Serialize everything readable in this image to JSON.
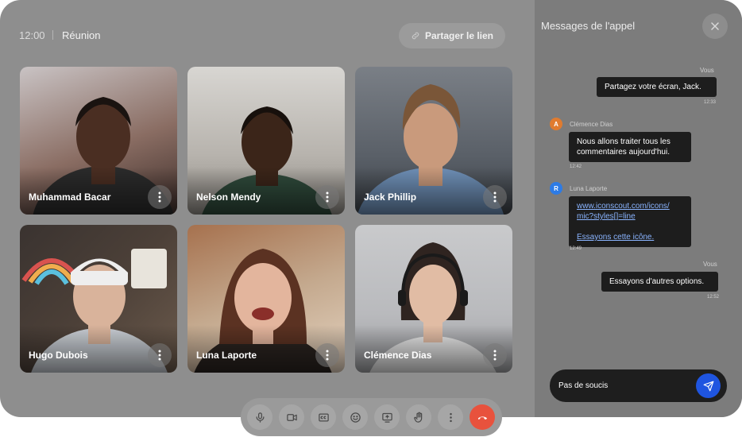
{
  "header": {
    "time": "12:00",
    "meeting_title": "Réunion",
    "share_label": "Partager le lien",
    "share_icon": "link-icon"
  },
  "participants": [
    {
      "name": "Muhammad Bacar",
      "bg": "#8a6d63",
      "skin": "#4a2e22",
      "hair": "#1a1310",
      "shirt": "#2b2b2b"
    },
    {
      "name": "Nelson Mendy",
      "bg": "#b7b3ad",
      "skin": "#3b2519",
      "hair": "#17100c",
      "shirt": "#2f4a3b"
    },
    {
      "name": "Jack Phillip",
      "bg": "#5a6068",
      "skin": "#c99a7c",
      "hair": "#7a5638",
      "shirt": "#6e8fb6"
    },
    {
      "name": "Hugo Dubois",
      "bg": "#4c4038",
      "skin": "#d9b39b",
      "hair": "#eeeeee",
      "shirt": "#c7ccd2"
    },
    {
      "name": "Luna Laporte",
      "bg": "#c4a98e",
      "skin": "#e3b59d",
      "hair": "#5b3222",
      "shirt": "#2b2420"
    },
    {
      "name": "Clémence Dias",
      "bg": "#b9babd",
      "skin": "#e1bca4",
      "hair": "#2f2420",
      "shirt": "#e6e6e6"
    }
  ],
  "controls": [
    {
      "icon": "microphone-icon",
      "label": "Micro"
    },
    {
      "icon": "video-camera-icon",
      "label": "Caméra"
    },
    {
      "icon": "captions-icon",
      "label": "CC"
    },
    {
      "icon": "emoji-icon",
      "label": "Réactions"
    },
    {
      "icon": "screen-share-icon",
      "label": "Partager l'écran"
    },
    {
      "icon": "raise-hand-icon",
      "label": "Lever la main"
    },
    {
      "icon": "more-icon",
      "label": "Plus"
    },
    {
      "icon": "end-call-icon",
      "label": "Raccrocher"
    }
  ],
  "chat": {
    "title": "Messages de l'appel",
    "messages": [
      {
        "sender": "Vous",
        "text": "Partagez votre écran, Jack.",
        "time": "12:33"
      },
      {
        "sender": "Clémence Dias",
        "initial": "A",
        "avatar_color": "#e07b2f",
        "text": "Nous allons traiter tous les commentaires aujourd'hui.",
        "time": "12:42"
      },
      {
        "sender": "Luna Laporte",
        "initial": "R",
        "avatar_color": "#2d7be5",
        "link": "www.iconscout.com/icons/mic?styles[]=line",
        "link_line1": "www.iconscout.com/icons/",
        "link_line2": "mic?styles[]=line",
        "text": "Essayons cette icône.",
        "time": "12:49"
      },
      {
        "sender": "Vous",
        "text": "Essayons d'autres options.",
        "time": "12:52"
      }
    ],
    "input_value": "Pas de soucis",
    "send_icon": "send-icon"
  }
}
